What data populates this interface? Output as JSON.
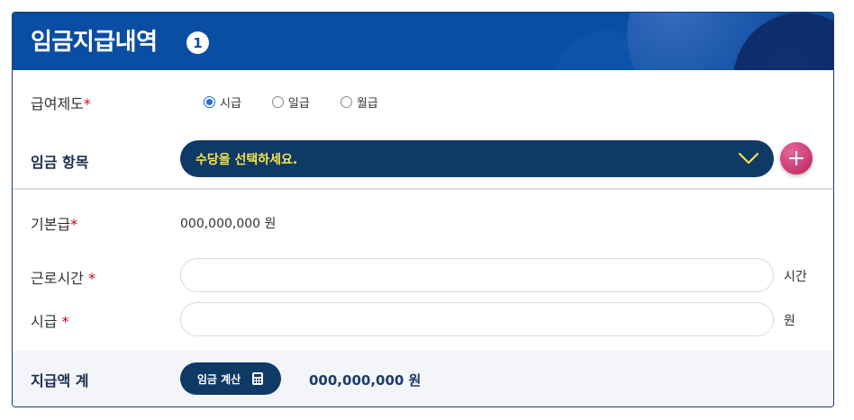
{
  "header": {
    "title": "임금지급내역",
    "badge": "1"
  },
  "pay_system": {
    "label": "급여제도",
    "required_mark": "*",
    "options": [
      {
        "label": "시급",
        "checked": true
      },
      {
        "label": "일급",
        "checked": false
      },
      {
        "label": "월급",
        "checked": false
      }
    ]
  },
  "wage_item": {
    "label": "임금 항목",
    "select_placeholder": "수당을 선택하세요.",
    "icons": {
      "select": "chevron-down-icon",
      "add": "plus-icon"
    }
  },
  "base_pay": {
    "label": "기본급",
    "required_mark": "*",
    "value": "000,000,000 원"
  },
  "work_hours": {
    "label": "근로시간 ",
    "required_mark": "*",
    "value": "",
    "unit": "시간"
  },
  "hourly_wage": {
    "label": "시급 ",
    "required_mark": "*",
    "value": "",
    "unit": "원"
  },
  "footer": {
    "label": "지급액 계",
    "calc_button": "임금 계산",
    "calc_icon": "calculator-icon",
    "total": "000,000,000 원"
  },
  "colors": {
    "header_bg": "#0a4ea3",
    "dark_navy": "#0f3a66",
    "select_text": "#f5e34a",
    "add_button": "#c9356f",
    "required": "#d0021b",
    "radio_checked": "#1e6fd0"
  }
}
